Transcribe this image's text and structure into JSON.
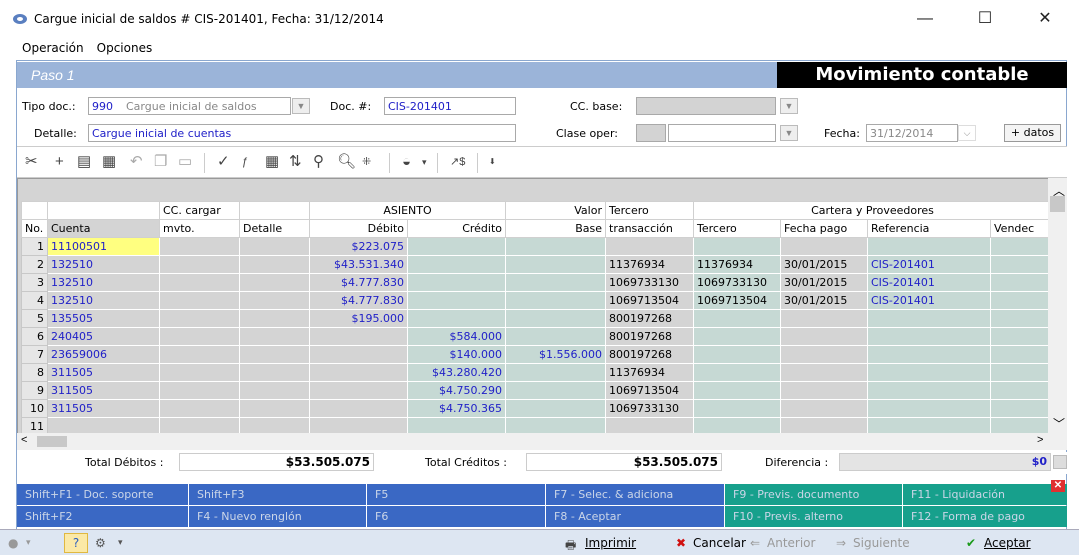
{
  "window": {
    "title": "Cargue inicial de saldos # CIS-201401, Fecha: 31/12/2014",
    "minimize": "—",
    "maximize": "☐",
    "close": "✕"
  },
  "menu": [
    "Operación",
    "Opciones"
  ],
  "header": {
    "paso": "Paso 1",
    "section": "Movimiento contable",
    "tipo_doc_label": "Tipo doc.:",
    "tipo_doc_code": "990",
    "tipo_doc_name": "Cargue inicial de saldos",
    "doc_num_label": "Doc. #:",
    "doc_num": "CIS-201401",
    "cc_base_label": "CC. base:",
    "detalle_label": "Detalle:",
    "detalle": "Cargue inicial de cuentas",
    "clase_oper_label": "Clase oper:",
    "fecha_label": "Fecha:",
    "fecha": "31/12/2014",
    "mas_datos": "+ datos"
  },
  "grid": {
    "group_headers": {
      "cc_cargar": "CC. cargar",
      "asiento": "ASIENTO",
      "valor": "Valor",
      "tercero": "Tercero",
      "cartera": "Cartera y Proveedores"
    },
    "columns": [
      "No.",
      "Cuenta",
      "mvto.",
      "Detalle",
      "Débito",
      "Crédito",
      "Base",
      "transacción",
      "Tercero",
      "Fecha pago",
      "Referencia",
      "Vendec"
    ],
    "rows": [
      {
        "no": "1",
        "cuenta": "11100501",
        "debito": "$223.075",
        "credito": "",
        "base": "",
        "trans": "",
        "tercero": "",
        "fecha": "",
        "ref": ""
      },
      {
        "no": "2",
        "cuenta": "132510",
        "debito": "$43.531.340",
        "credito": "",
        "base": "",
        "trans": "11376934",
        "tercero": "11376934",
        "fecha": "30/01/2015",
        "ref": "CIS-201401"
      },
      {
        "no": "3",
        "cuenta": "132510",
        "debito": "$4.777.830",
        "credito": "",
        "base": "",
        "trans": "1069733130",
        "tercero": "1069733130",
        "fecha": "30/01/2015",
        "ref": "CIS-201401"
      },
      {
        "no": "4",
        "cuenta": "132510",
        "debito": "$4.777.830",
        "credito": "",
        "base": "",
        "trans": "1069713504",
        "tercero": "1069713504",
        "fecha": "30/01/2015",
        "ref": "CIS-201401"
      },
      {
        "no": "5",
        "cuenta": "135505",
        "debito": "$195.000",
        "credito": "",
        "base": "",
        "trans": "800197268",
        "tercero": "",
        "fecha": "",
        "ref": ""
      },
      {
        "no": "6",
        "cuenta": "240405",
        "debito": "",
        "credito": "$584.000",
        "base": "",
        "trans": "800197268",
        "tercero": "",
        "fecha": "",
        "ref": ""
      },
      {
        "no": "7",
        "cuenta": "23659006",
        "debito": "",
        "credito": "$140.000",
        "base": "$1.556.000",
        "trans": "800197268",
        "tercero": "",
        "fecha": "",
        "ref": ""
      },
      {
        "no": "8",
        "cuenta": "311505",
        "debito": "",
        "credito": "$43.280.420",
        "base": "",
        "trans": "11376934",
        "tercero": "",
        "fecha": "",
        "ref": ""
      },
      {
        "no": "9",
        "cuenta": "311505",
        "debito": "",
        "credito": "$4.750.290",
        "base": "",
        "trans": "1069713504",
        "tercero": "",
        "fecha": "",
        "ref": ""
      },
      {
        "no": "10",
        "cuenta": "311505",
        "debito": "",
        "credito": "$4.750.365",
        "base": "",
        "trans": "1069733130",
        "tercero": "",
        "fecha": "",
        "ref": ""
      },
      {
        "no": "11",
        "cuenta": "",
        "debito": "",
        "credito": "",
        "base": "",
        "trans": "",
        "tercero": "",
        "fecha": "",
        "ref": ""
      }
    ]
  },
  "totals": {
    "debitos_label": "Total Débitos :",
    "debitos": "$53.505.075",
    "creditos_label": "Total Créditos :",
    "creditos": "$53.505.075",
    "diferencia_label": "Diferencia :",
    "diferencia": "$0"
  },
  "fkeys": [
    "Shift+F1 - Doc. soporte",
    "Shift+F3",
    "F5",
    "F7 - Selec. & adiciona",
    "F9 - Previs. documento",
    "F11 - Liquidación",
    "Shift+F2",
    "F4 - Nuevo renglón",
    "F6",
    "F8 - Aceptar",
    "F10 - Previs. alterno",
    "F12 - Forma de pago"
  ],
  "status": {
    "imprimir": "Imprimir",
    "cancelar": "Cancelar",
    "anterior": "Anterior",
    "siguiente": "Siguiente",
    "aceptar": "Aceptar"
  },
  "colors": {
    "paso_bar": "#9bb4d9",
    "fk_blue": "#3a68c4",
    "fk_teal": "#17a08c",
    "accent_text": "#2020c8"
  }
}
